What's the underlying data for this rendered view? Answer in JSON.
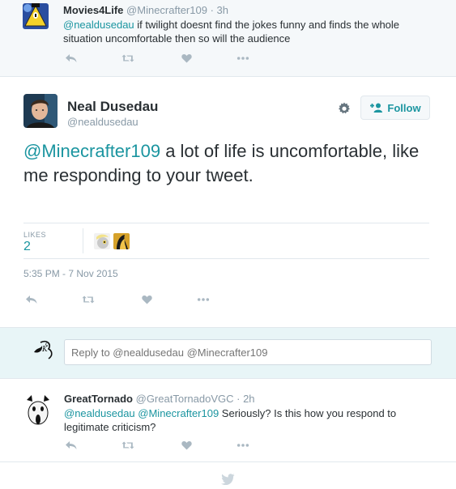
{
  "parent_tweet": {
    "name": "Movies4Life",
    "handle": "@Minecrafter109",
    "time": "3h",
    "mention": "@nealdusedau",
    "text": " if twilight doesnt find the jokes funny and finds the whole situation uncomfortable then so will the audience"
  },
  "main_tweet": {
    "name": "Neal Dusedau",
    "handle": "@nealdusedau",
    "follow_label": "Follow",
    "mention": "@Minecrafter109",
    "text": " a lot of life is uncomfortable, like me responding to your tweet.",
    "likes_label": "LIKES",
    "likes_count": "2",
    "timestamp": "5:35 PM - 7 Nov 2015"
  },
  "reply_box": {
    "placeholder": "Reply to @nealdusedau @Minecrafter109"
  },
  "reply_tweet": {
    "name": "GreatTornado",
    "handle": "@GreatTornadoVGC",
    "time": "2h",
    "mention1": "@nealdusedau",
    "mention2": "@Minecrafter109",
    "text": " Seriously? Is this how you respond to legitimate criticism?"
  },
  "icons": [
    "reply-icon",
    "retweet-icon",
    "like-icon",
    "more-icon",
    "gear-icon",
    "follow-icon",
    "bird-icon"
  ],
  "colors": {
    "link": "#1b95a0",
    "muted": "#8899a6",
    "icon": "#aab8c2",
    "reply_bg": "#e8f5f7",
    "parent_bg": "#f5f8fa"
  }
}
